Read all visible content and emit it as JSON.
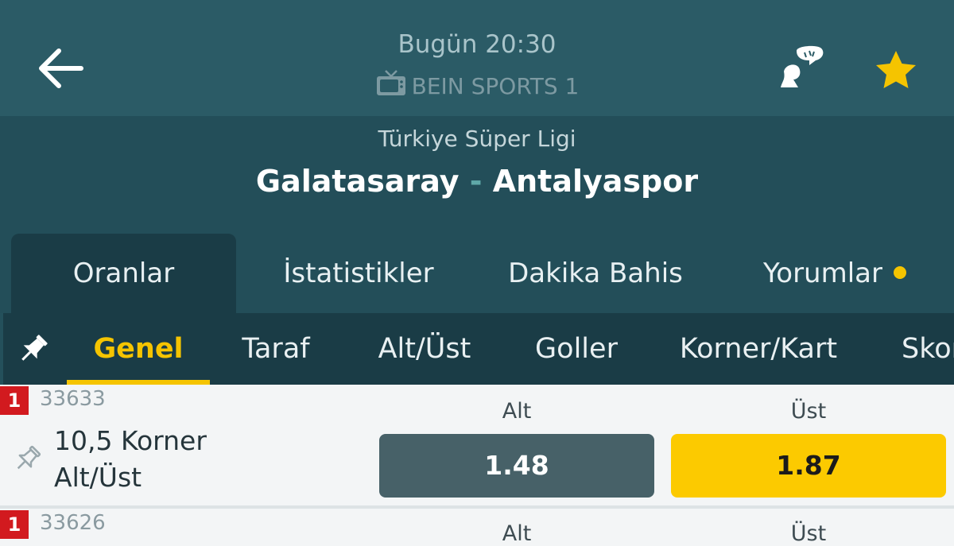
{
  "header": {
    "time": "Bugün 20:30",
    "channel": "BEIN SPORTS 1"
  },
  "match": {
    "league": "Türkiye Süper Ligi",
    "home": "Galatasaray",
    "separator": "-",
    "away": "Antalyaspor"
  },
  "tabs": [
    {
      "label": "Oranlar",
      "active": true
    },
    {
      "label": "İstatistikler"
    },
    {
      "label": "Dakika Bahis"
    },
    {
      "label": "Yorumlar",
      "has_dot": true
    }
  ],
  "subtabs": [
    {
      "label": "Genel",
      "active": true
    },
    {
      "label": "Taraf"
    },
    {
      "label": "Alt/Üst"
    },
    {
      "label": "Goller"
    },
    {
      "label": "Korner/Kart"
    },
    {
      "label": "Skor"
    }
  ],
  "markets": [
    {
      "badge": "1",
      "code": "33633",
      "title_line1": "10,5 Korner",
      "title_line2": "Alt/Üst",
      "label_alt": "Alt",
      "label_ust": "Üst",
      "odd_alt": "1.48",
      "odd_ust": "1.87"
    },
    {
      "badge": "1",
      "code": "33626",
      "label_alt": "Alt",
      "label_ust": "Üst"
    }
  ],
  "colors": {
    "header_bg": "#2b5b66",
    "match_bg": "#234e59",
    "subnav_bg": "#1a3c46",
    "accent_yellow": "#f5c400",
    "badge_red": "#d21a1f",
    "odd_alt_bg": "#476168",
    "odd_ust_bg": "#fcca00"
  },
  "icons": [
    "arrow-left-icon",
    "tv-icon",
    "speech-person-icon",
    "star-icon",
    "pin-icon",
    "pin-outline-icon"
  ]
}
